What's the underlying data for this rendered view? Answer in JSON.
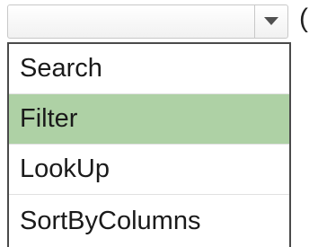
{
  "combo": {
    "value": "",
    "trailing_text": "("
  },
  "dropdown": {
    "selected_index": 1,
    "items": [
      {
        "label": "Search"
      },
      {
        "label": "Filter"
      },
      {
        "label": "LookUp"
      },
      {
        "label": "SortByColumns"
      }
    ]
  },
  "colors": {
    "selected_item_bg": "#aed1a5",
    "list_border": "#4a4a4a"
  },
  "icons": {
    "dropdown_button": "triangle-down-icon"
  }
}
